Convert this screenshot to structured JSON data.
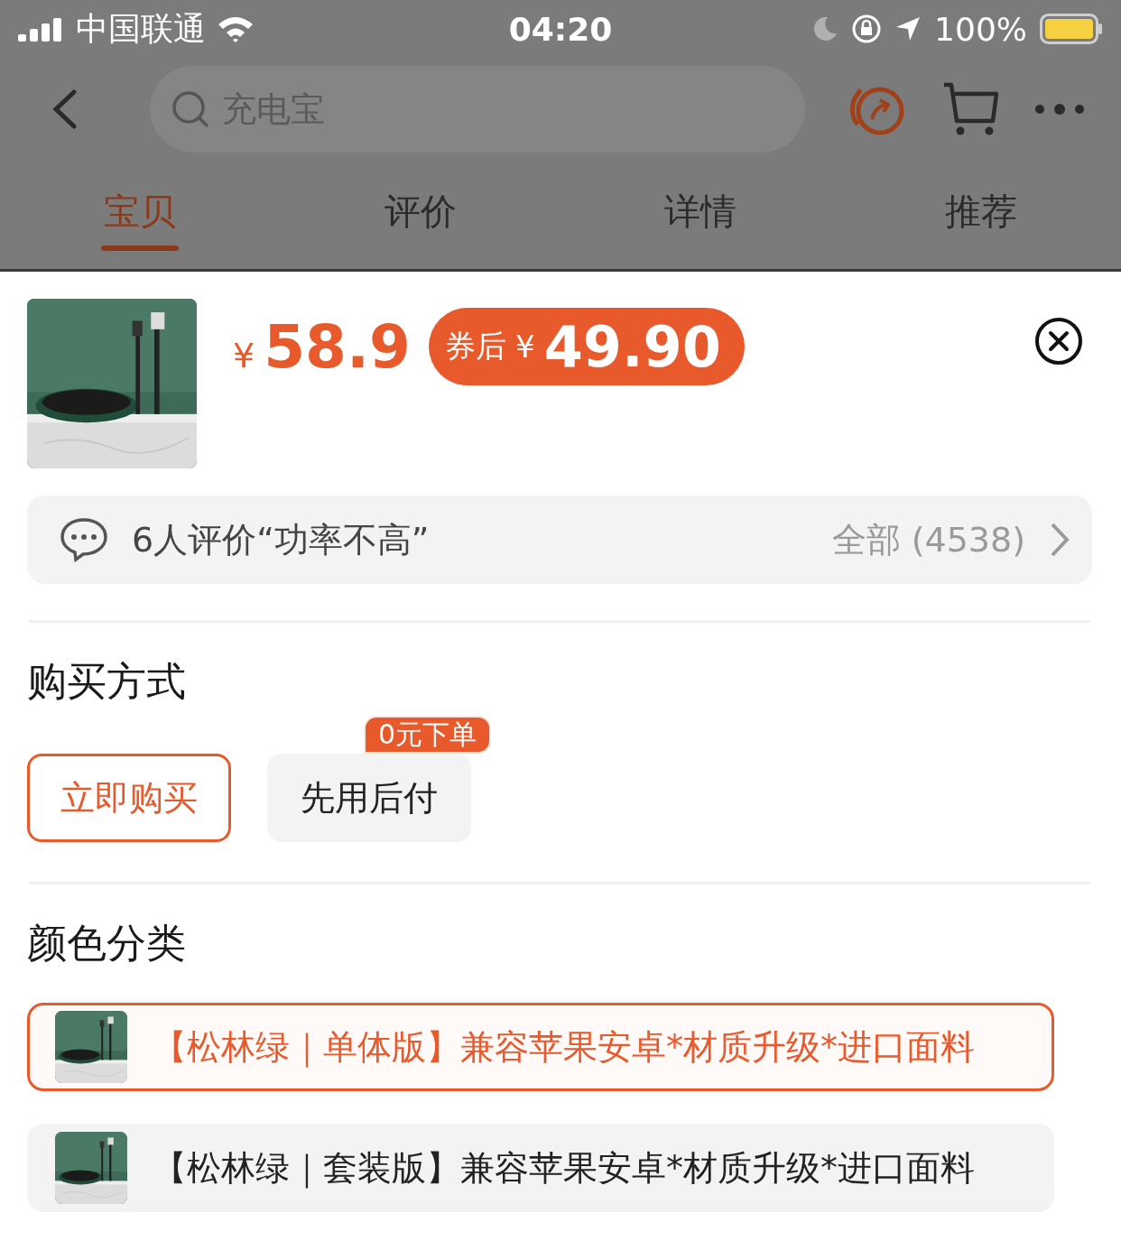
{
  "status_bar": {
    "carrier": "中国联通",
    "time": "04:20",
    "battery": "100%"
  },
  "search": {
    "placeholder": "充电宝"
  },
  "tabs": [
    {
      "label": "宝贝",
      "selected": true
    },
    {
      "label": "评价",
      "selected": false
    },
    {
      "label": "详情",
      "selected": false
    },
    {
      "label": "推荐",
      "selected": false
    }
  ],
  "product": {
    "price_symbol": "¥",
    "price": "58.9",
    "coupon": {
      "label": "券后",
      "symbol": "¥",
      "price": "49.90"
    }
  },
  "review": {
    "text": "6人评价“功率不高”",
    "more": "全部 (4538)"
  },
  "purchase_method": {
    "title": "购买方式",
    "options": [
      {
        "label": "立即购买",
        "selected": true
      },
      {
        "label": "先用后付",
        "selected": false,
        "badge": "0元下单"
      }
    ]
  },
  "color_category": {
    "title": "颜色分类",
    "options": [
      {
        "label": "【松林绿｜单体版】兼容苹果安卓*材质升级*进口面料",
        "selected": true
      },
      {
        "label": "【松林绿｜套装版】兼容苹果安卓*材质升级*进口面料",
        "selected": false
      }
    ]
  }
}
